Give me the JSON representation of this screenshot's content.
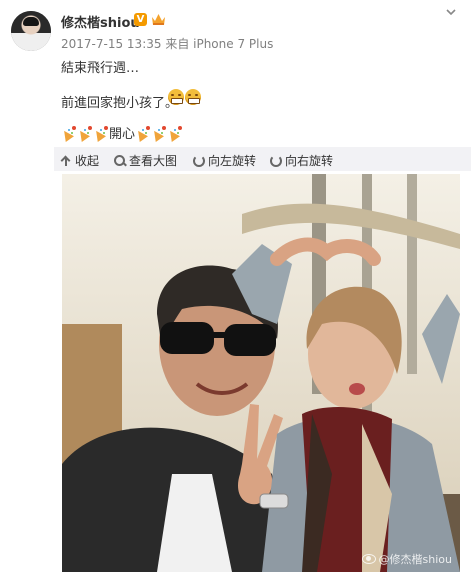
{
  "post": {
    "author": "修杰楷shiou",
    "verified_badge": "V",
    "meta": "2017-7-15 13:35 来自 iPhone 7 Plus",
    "text_line1": "結束飛行週…",
    "text_line2": "前進回家抱小孩了。",
    "text_line3": "開心",
    "emojis": [
      "grin-emoji",
      "grin-emoji"
    ],
    "party_icons_count": 6
  },
  "toolbar": {
    "collapse": "收起",
    "view_large": "查看大图",
    "rotate_left": "向左旋转",
    "rotate_right": "向右旋转"
  },
  "photo": {
    "watermark": "@修杰楷shiou"
  },
  "colors": {
    "badge": "#f49a00",
    "toolbar_bg": "#f2f2f5"
  }
}
